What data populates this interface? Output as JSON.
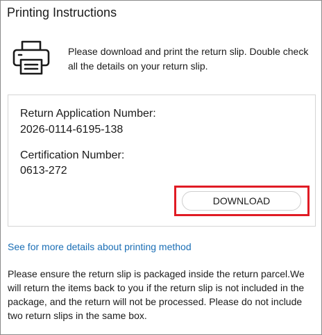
{
  "header": {
    "title": "Printing Instructions"
  },
  "intro": {
    "icon": "printer-icon",
    "text": "Please download and print the return slip. Double check all the details on your return slip."
  },
  "details": {
    "application_label": "Return Application Number:",
    "application_number": "2026-0114-6195-138",
    "certification_label": "Certification Number:",
    "certification_number": "0613-272"
  },
  "actions": {
    "download_label": "DOWNLOAD",
    "highlight_color": "#e01b24"
  },
  "link": {
    "text": "See for more details about printing method",
    "color": "#1a6eb5"
  },
  "note": {
    "text": "Please ensure the return slip is packaged inside the return parcel.We will return the items back to you if the return slip is not included in the package, and the return will not be processed. Please do not include two return slips in the same box."
  }
}
